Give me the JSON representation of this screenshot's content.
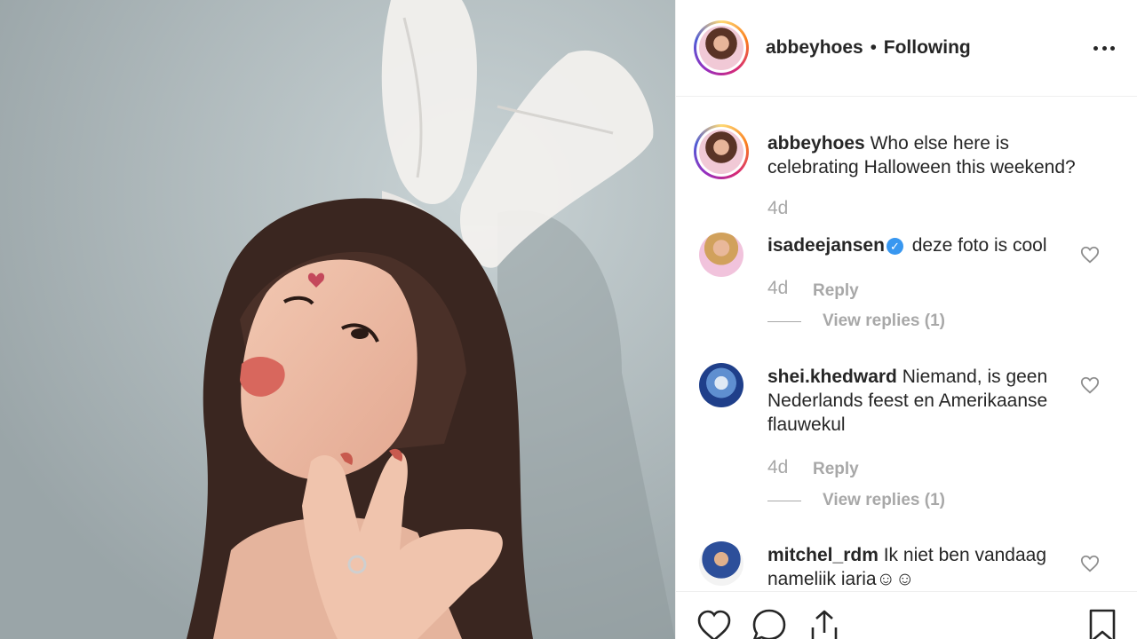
{
  "post": {
    "username": "abbeyhoes",
    "separator": "•",
    "follow_status": "Following",
    "caption": "Who else here is celebrating Halloween this weekend?",
    "caption_age": "4d"
  },
  "comments": [
    {
      "username": "isadeejansen",
      "verified": true,
      "text": "deze foto is cool",
      "age": "4d",
      "reply_label": "Reply",
      "view_replies": "View replies (1)"
    },
    {
      "username": "shei.khedward",
      "verified": false,
      "text": "Niemand, is geen Nederlands feest en Amerikaanse flauwekul",
      "age": "4d",
      "reply_label": "Reply",
      "view_replies": "View replies (1)"
    },
    {
      "username": "mitchel_rdm",
      "verified": false,
      "text": "Ik niet ben vandaag nameliik iaria☺☺"
    }
  ],
  "icons": {
    "more": "more-options-icon",
    "like": "heart-icon",
    "comment": "comment-icon",
    "share": "share-icon",
    "save": "bookmark-icon",
    "verified": "verified-badge-icon"
  },
  "colors": {
    "text": "#262626",
    "secondary": "#a8a8a8",
    "verified": "#3897f0",
    "divider": "#efefef"
  }
}
